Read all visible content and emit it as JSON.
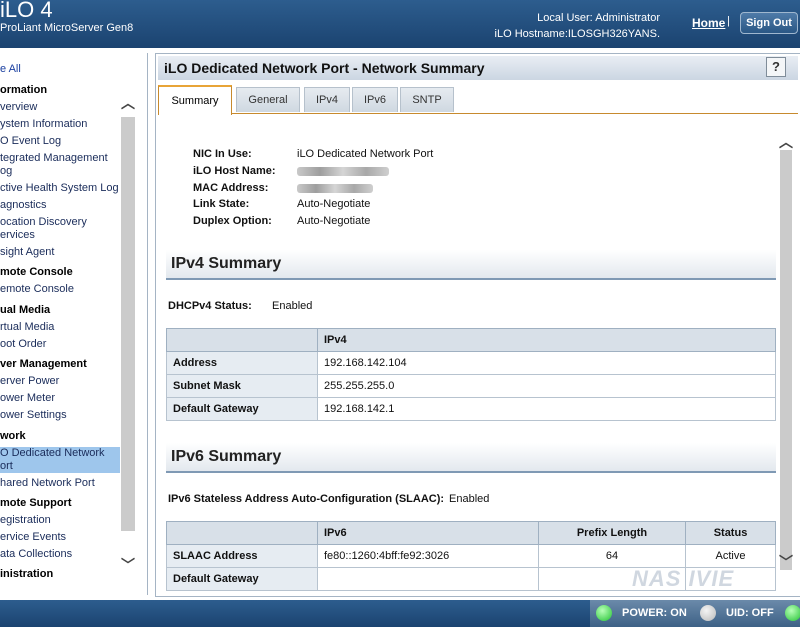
{
  "header": {
    "title": "iLO 4",
    "subtitle": "ProLiant MicroServer Gen8",
    "local_user": "Local User:  Administrator",
    "hostname": "iLO Hostname:ILOSGH326YANS.",
    "home_label": "Home",
    "separator": "|",
    "signout_label": "Sign Out"
  },
  "sidebar": {
    "items": [
      {
        "label": "e All",
        "kind": "expand"
      },
      {
        "label": "ormation",
        "kind": "head"
      },
      {
        "label": "verview",
        "kind": "item"
      },
      {
        "label": "ystem Information",
        "kind": "item"
      },
      {
        "label": "O Event Log",
        "kind": "item"
      },
      {
        "label": "tegrated Management og",
        "kind": "item"
      },
      {
        "label": "ctive Health System Log",
        "kind": "item"
      },
      {
        "label": "agnostics",
        "kind": "item"
      },
      {
        "label": "ocation Discovery ervices",
        "kind": "item"
      },
      {
        "label": "sight Agent",
        "kind": "item"
      },
      {
        "label": "mote Console",
        "kind": "head"
      },
      {
        "label": "emote Console",
        "kind": "item"
      },
      {
        "label": "ual Media",
        "kind": "head"
      },
      {
        "label": "rtual Media",
        "kind": "item"
      },
      {
        "label": "oot Order",
        "kind": "item"
      },
      {
        "label": "ver Management",
        "kind": "head"
      },
      {
        "label": "erver Power",
        "kind": "item"
      },
      {
        "label": "ower Meter",
        "kind": "item"
      },
      {
        "label": "ower Settings",
        "kind": "item"
      },
      {
        "label": "work",
        "kind": "head"
      },
      {
        "label": "O Dedicated Network ort",
        "kind": "active"
      },
      {
        "label": "hared Network Port",
        "kind": "item"
      },
      {
        "label": "mote Support",
        "kind": "head"
      },
      {
        "label": "egistration",
        "kind": "item"
      },
      {
        "label": "ervice Events",
        "kind": "item"
      },
      {
        "label": "ata Collections",
        "kind": "item"
      },
      {
        "label": "inistration",
        "kind": "head"
      }
    ]
  },
  "main": {
    "title": "iLO Dedicated Network Port - Network Summary",
    "help_label": "?",
    "tabs": [
      "Summary",
      "General",
      "IPv4",
      "IPv6",
      "SNTP"
    ],
    "nic": {
      "rows": [
        {
          "label": "NIC In Use:",
          "value": "iLO Dedicated Network Port"
        },
        {
          "label": "iLO Host Name:",
          "value": ""
        },
        {
          "label": "MAC Address:",
          "value": ""
        },
        {
          "label": "Link State:",
          "value": "Auto-Negotiate"
        },
        {
          "label": "Duplex Option:",
          "value": "Auto-Negotiate"
        }
      ]
    },
    "ipv4": {
      "title": "IPv4 Summary",
      "dhcp_label": "DHCPv4 Status:",
      "dhcp_value": "Enabled",
      "col_header": "IPv4",
      "rows": [
        {
          "label": "Address",
          "value": "192.168.142.104"
        },
        {
          "label": "Subnet Mask",
          "value": "255.255.255.0"
        },
        {
          "label": "Default Gateway",
          "value": "192.168.142.1"
        }
      ]
    },
    "ipv6": {
      "title": "IPv6 Summary",
      "slaac_label": "IPv6 Stateless Address Auto-Configuration (SLAAC):",
      "slaac_value": "Enabled",
      "headers": [
        "IPv6",
        "Prefix Length",
        "Status"
      ],
      "rows": [
        {
          "label": "SLAAC Address",
          "ipv6": "fe80::1260:4bff:fe92:3026",
          "prefix": "64",
          "status": "Active"
        },
        {
          "label": "Default Gateway",
          "ipv6": "",
          "prefix": "",
          "status": ""
        }
      ]
    }
  },
  "footer": {
    "power_label": "POWER: ON",
    "uid_label": "UID: OFF",
    "watermark": "NAS IVIE",
    "colors": {
      "power_led": "#22c232",
      "uid_led": "#b9b9b9",
      "accent_tab": "#e8a437"
    }
  }
}
